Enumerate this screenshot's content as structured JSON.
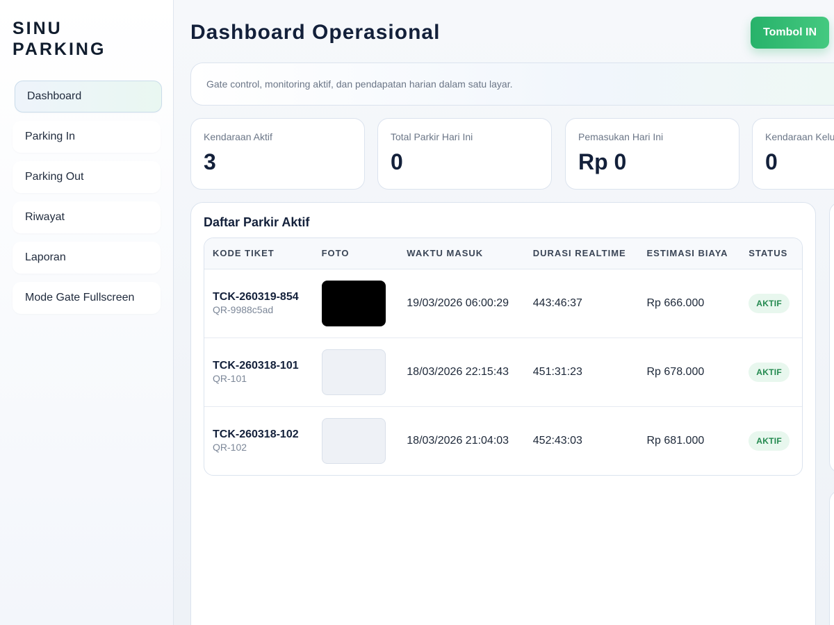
{
  "brand": {
    "line1": "SINU",
    "line2": "PARKING"
  },
  "nav": [
    {
      "label": "Dashboard",
      "active": true
    },
    {
      "label": "Parking In"
    },
    {
      "label": "Parking Out"
    },
    {
      "label": "Riwayat"
    },
    {
      "label": "Laporan"
    },
    {
      "label": "Mode Gate Fullscreen"
    }
  ],
  "header": {
    "title": "Dashboard Operasional",
    "button_label": "Tombol IN",
    "subtitle": "Gate control, monitoring aktif, dan pendapatan harian dalam satu layar."
  },
  "stats": [
    {
      "label": "Kendaraan Aktif",
      "value": "3"
    },
    {
      "label": "Total Parkir Hari Ini",
      "value": "0"
    },
    {
      "label": "Pemasukan Hari Ini",
      "value": "Rp 0"
    },
    {
      "label": "Kendaraan Keluar",
      "value": "0"
    }
  ],
  "panel": {
    "title": "Daftar Parkir Aktif",
    "columns": [
      "KODE TIKET",
      "FOTO",
      "WAKTU MASUK",
      "DURASI REALTIME",
      "ESTIMASI BIAYA",
      "STATUS"
    ],
    "rows": [
      {
        "code": "TCK-260319-854",
        "qr": "QR-9988c5ad",
        "photo": "dark",
        "entry": "19/03/2026 06:00:29",
        "duration": "443:46:37",
        "cost": "Rp 666.000",
        "status": "AKTIF"
      },
      {
        "code": "TCK-260318-101",
        "qr": "QR-101",
        "photo": "empty",
        "entry": "18/03/2026 22:15:43",
        "duration": "451:31:23",
        "cost": "Rp 678.000",
        "status": "AKTIF"
      },
      {
        "code": "TCK-260318-102",
        "qr": "QR-102",
        "photo": "empty",
        "entry": "18/03/2026 21:04:03",
        "duration": "452:43:03",
        "cost": "Rp 681.000",
        "status": "AKTIF"
      }
    ]
  },
  "colors": {
    "accent": "#27b26a",
    "badge_bg": "#e8f7ee",
    "badge_text": "#23894f"
  }
}
